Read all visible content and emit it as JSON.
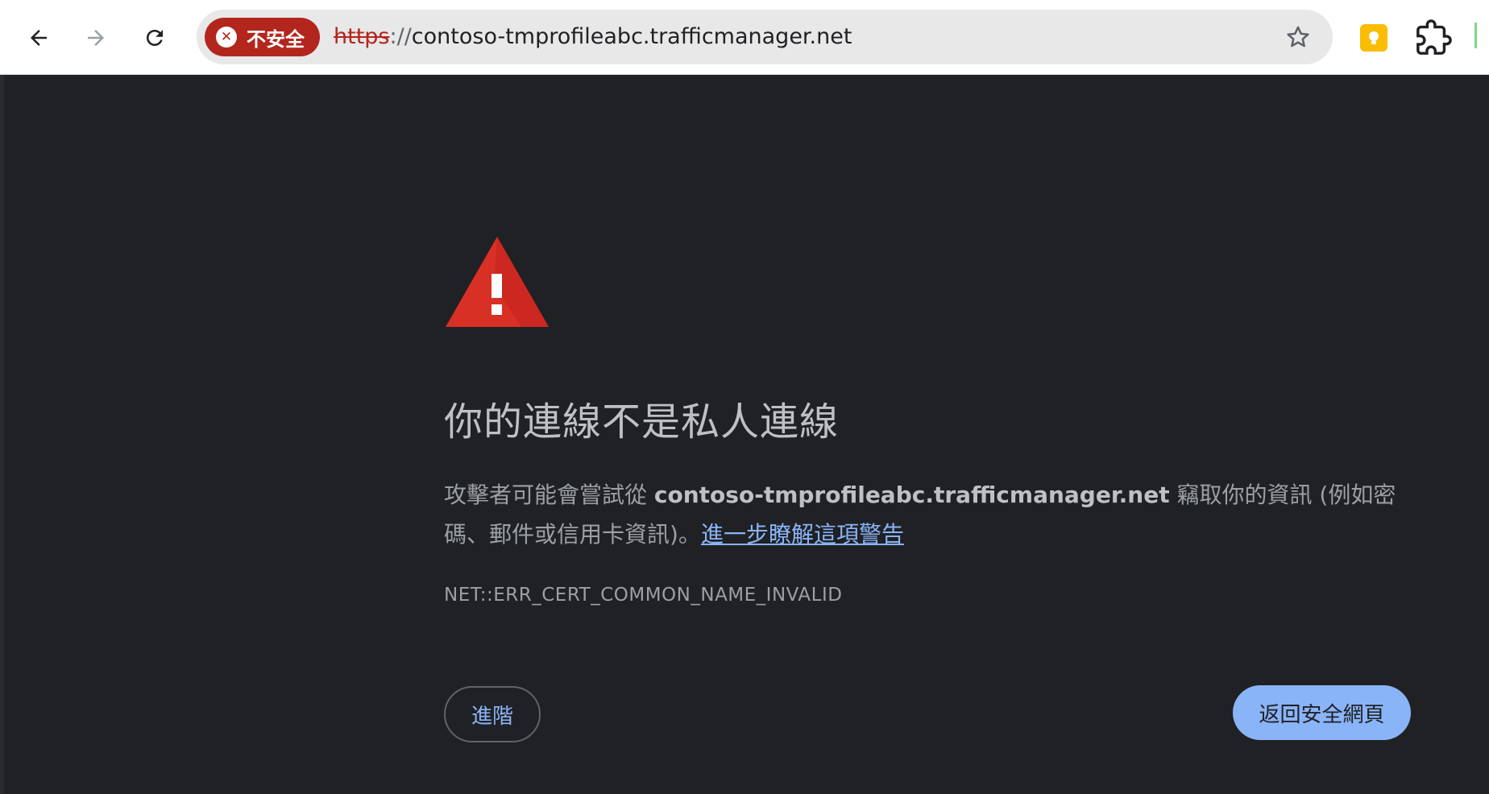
{
  "toolbar": {
    "back_icon": "arrow-left-icon",
    "forward_icon": "arrow-right-icon",
    "reload_icon": "reload-icon",
    "security_chip": {
      "label": "不安全",
      "icon": "error-x-icon",
      "color": "#b3261e"
    },
    "url": {
      "scheme": "https",
      "separator": "://",
      "host": "contoso-tmprofileabc.trafficmanager.net"
    },
    "star_icon": "bookmark-star-icon",
    "extensions": [
      "extension-yellow-icon",
      "puzzle-icon"
    ]
  },
  "interstitial": {
    "icon": "warning-triangle-icon",
    "title": "你的連線不是私人連線",
    "description_prefix": "攻擊者可能會嘗試從 ",
    "description_host": "contoso-tmprofileabc.trafficmanager.net",
    "description_suffix": " 竊取你的資訊 (例如密碼、郵件或信用卡資訊)。",
    "learn_more_link": "進一步瞭解這項警告",
    "error_code": "NET::ERR_CERT_COMMON_NAME_INVALID",
    "advanced_button": "進階",
    "back_to_safety_button": "返回安全網頁",
    "colors": {
      "background": "#202124",
      "warning_red": "#d93025",
      "link_blue": "#8ab4f8"
    }
  }
}
